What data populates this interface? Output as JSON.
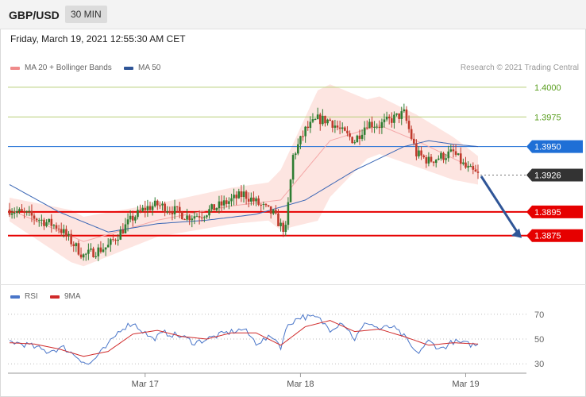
{
  "header": {
    "pair": "GBP/USD",
    "timeframe": "30 MIN"
  },
  "timestamp": "Friday, March 19, 2021 12:55:30 AM CET",
  "legend": {
    "ma20_label": "MA 20 + Bollinger Bands",
    "ma20_color": "#f08b8b",
    "ma50_label": "MA 50",
    "ma50_color": "#2f5597"
  },
  "copyright": "Research © 2021 Trading Central",
  "colors": {
    "up": "#2e7d32",
    "down": "#c0392b",
    "band": "#fde0dc",
    "support": "#e60000",
    "ma50_line": "#3a66b5",
    "current": "#333333"
  },
  "chart_data": [
    {
      "type": "candlestick",
      "title": "GBP/USD 30 MIN",
      "x_ticks": [
        "Mar 17",
        "Mar 18",
        "Mar 19"
      ],
      "ylim": [
        1.3838,
        1.4012
      ],
      "levels": [
        {
          "value": "1.4000",
          "kind": "resistance",
          "color": "#9bbf4b"
        },
        {
          "value": "1.3975",
          "kind": "resistance",
          "color": "#9bbf4b"
        },
        {
          "value": "1.3950",
          "kind": "ma50",
          "color": "#1f6fd6"
        },
        {
          "value": "1.3926",
          "kind": "current",
          "color": "#333333"
        },
        {
          "value": "1.3895",
          "kind": "support",
          "color": "#e60000"
        },
        {
          "value": "1.3875",
          "kind": "support",
          "color": "#e60000"
        }
      ],
      "anchors": {
        "t": [
          0,
          8,
          20,
          30,
          40,
          50,
          55,
          60,
          67,
          72,
          78,
          85,
          95,
          100,
          107,
          110,
          112,
          115,
          120,
          125,
          130,
          135,
          140,
          145,
          150,
          160,
          165,
          170,
          180,
          185,
          190
        ],
        "close": [
          1.3897,
          1.3892,
          1.3882,
          1.3858,
          1.3866,
          1.389,
          1.3898,
          1.3901,
          1.3896,
          1.3891,
          1.3893,
          1.39,
          1.391,
          1.3903,
          1.3893,
          1.3883,
          1.388,
          1.3942,
          1.3964,
          1.3973,
          1.3972,
          1.3962,
          1.3955,
          1.397,
          1.3968,
          1.3978,
          1.3944,
          1.3938,
          1.3945,
          1.3932,
          1.3926
        ]
      },
      "ma20": {
        "t": [
          0,
          30,
          60,
          90,
          110,
          118,
          130,
          150,
          165,
          190
        ],
        "v": [
          1.3897,
          1.387,
          1.3888,
          1.39,
          1.3905,
          1.3925,
          1.3955,
          1.3968,
          1.3955,
          1.393
        ]
      },
      "ma50": {
        "t": [
          0,
          20,
          40,
          60,
          80,
          100,
          120,
          140,
          150,
          160,
          170,
          180,
          190
        ],
        "v": [
          1.3918,
          1.3895,
          1.3878,
          1.3885,
          1.3888,
          1.3893,
          1.3905,
          1.393,
          1.394,
          1.395,
          1.3955,
          1.3952,
          1.395
        ]
      },
      "band_width": {
        "t": [
          0,
          25,
          60,
          105,
          115,
          125,
          145,
          165,
          180,
          190
        ],
        "v": [
          0.001,
          0.0022,
          0.0014,
          0.0016,
          0.0035,
          0.0055,
          0.0025,
          0.0022,
          0.0018,
          0.0012
        ]
      },
      "forecast_arrow": {
        "from": 1.3925,
        "to": 1.3873
      }
    },
    {
      "type": "line",
      "series": [
        {
          "name": "RSI",
          "color": "#4a76c9"
        },
        {
          "name": "9MA",
          "color": "#d02a2a"
        }
      ],
      "ylim": [
        25,
        75
      ],
      "y_ticks": [
        "70",
        "50",
        "30"
      ],
      "rsi": {
        "t": [
          0,
          8,
          15,
          22,
          28,
          32,
          40,
          45,
          50,
          58,
          63,
          70,
          75,
          80,
          88,
          95,
          100,
          107,
          110,
          113,
          118,
          125,
          130,
          135,
          140,
          145,
          150,
          155,
          160,
          165,
          170,
          175,
          180,
          185,
          190
        ],
        "v": [
          48,
          45,
          40,
          43,
          35,
          29,
          45,
          58,
          63,
          50,
          55,
          52,
          47,
          50,
          55,
          58,
          47,
          52,
          44,
          62,
          68,
          67,
          58,
          64,
          50,
          64,
          58,
          60,
          52,
          38,
          48,
          42,
          48,
          46,
          45
        ]
      },
      "ma9": {
        "t": [
          0,
          10,
          20,
          30,
          40,
          50,
          60,
          70,
          80,
          90,
          100,
          110,
          120,
          130,
          140,
          150,
          160,
          170,
          180,
          190
        ],
        "v": [
          47,
          46,
          42,
          36,
          40,
          54,
          57,
          52,
          50,
          55,
          55,
          45,
          60,
          65,
          56,
          58,
          52,
          45,
          47,
          46
        ]
      }
    }
  ]
}
